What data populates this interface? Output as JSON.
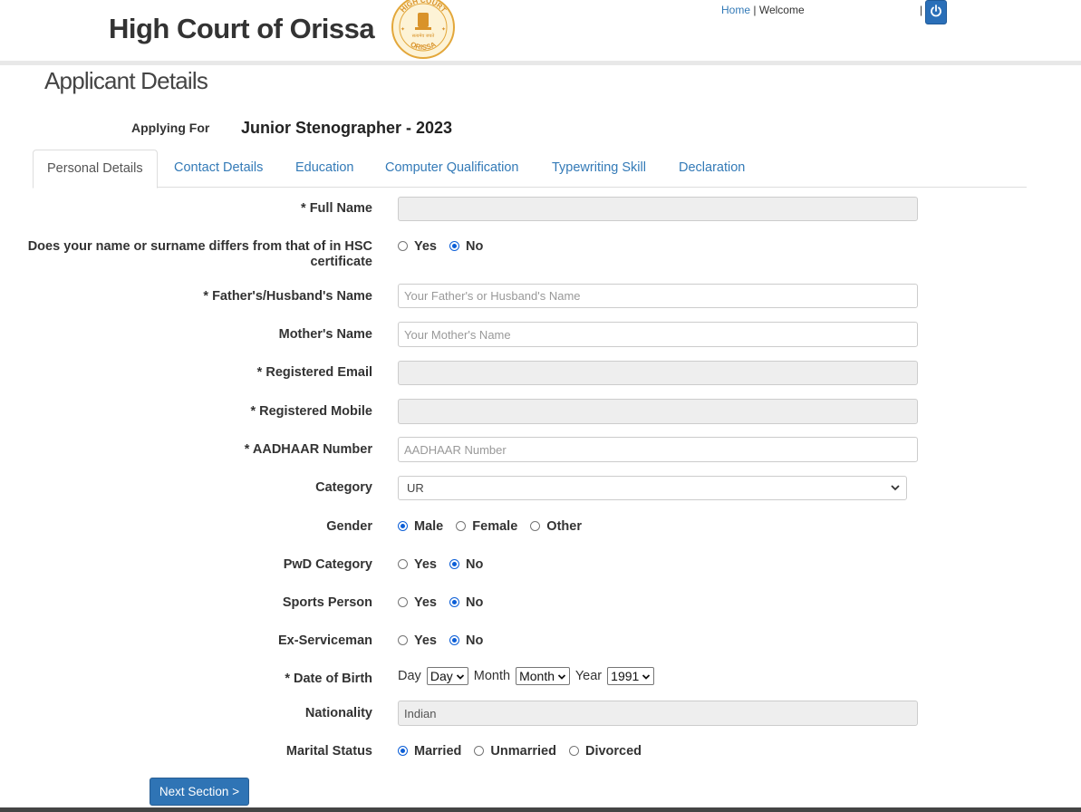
{
  "header": {
    "site_title": "High Court of Orissa",
    "emblem_text_top": "HIGH COURT",
    "emblem_text_bottom": "ORISSA",
    "emblem_motto": "सत्यमेव जयते",
    "home_link": "Home",
    "separator": "|",
    "welcome": "Welcome",
    "bar": "|",
    "power_icon": "power-icon",
    "accent_color": "#2a6fb8"
  },
  "page": {
    "heading": "Applicant Details",
    "applying_for_label": "Applying For",
    "applying_for_value": "Junior Stenographer - 2023"
  },
  "tabs": [
    {
      "label": "Personal Details",
      "active": true
    },
    {
      "label": "Contact Details",
      "active": false
    },
    {
      "label": "Education",
      "active": false
    },
    {
      "label": "Computer Qualification",
      "active": false
    },
    {
      "label": "Typewriting Skill",
      "active": false
    },
    {
      "label": "Declaration",
      "active": false
    }
  ],
  "form": {
    "full_name": {
      "label": "* Full Name",
      "value": ""
    },
    "name_differs": {
      "label": "Does your name or surname differs from that of in HSC certificate",
      "options": [
        "Yes",
        "No"
      ],
      "selected": "No"
    },
    "father_name": {
      "label": "* Father's/Husband's Name",
      "placeholder": "Your Father's or Husband's Name"
    },
    "mother_name": {
      "label": "Mother's Name",
      "placeholder": "Your Mother's Name"
    },
    "email": {
      "label": "* Registered Email",
      "value": ""
    },
    "mobile": {
      "label": "* Registered Mobile",
      "value": ""
    },
    "aadhaar": {
      "label": "* AADHAAR Number",
      "placeholder": "AADHAAR Number"
    },
    "category": {
      "label": "Category",
      "value": "UR"
    },
    "gender": {
      "label": "Gender",
      "options": [
        "Male",
        "Female",
        "Other"
      ],
      "selected": "Male"
    },
    "pwd": {
      "label": "PwD Category",
      "options": [
        "Yes",
        "No"
      ],
      "selected": "No"
    },
    "sports": {
      "label": "Sports Person",
      "options": [
        "Yes",
        "No"
      ],
      "selected": "No"
    },
    "ex_serviceman": {
      "label": "Ex-Serviceman",
      "options": [
        "Yes",
        "No"
      ],
      "selected": "No"
    },
    "dob": {
      "label": "* Date of Birth",
      "day_label": "Day",
      "day_value": "Day",
      "month_label": "Month",
      "month_value": "Month",
      "year_label": "Year",
      "year_value": "1991"
    },
    "nationality": {
      "label": "Nationality",
      "value": "Indian"
    },
    "marital": {
      "label": "Marital Status",
      "options": [
        "Married",
        "Unmarried",
        "Divorced"
      ],
      "selected": "Married"
    }
  },
  "next_button": "Next Section >"
}
